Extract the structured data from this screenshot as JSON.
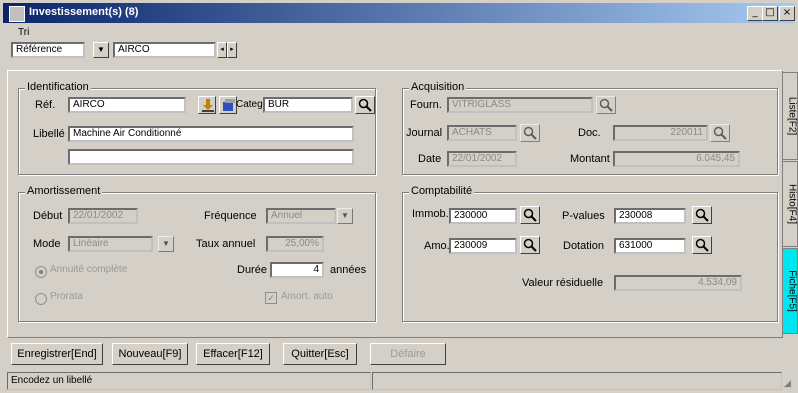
{
  "window": {
    "title": "Investissement(s) (8)"
  },
  "tri": {
    "label": "Tri",
    "select_value": "Référence",
    "search_value": "AIRCO"
  },
  "identification": {
    "title": "Identification",
    "ref_label": "Réf.",
    "ref_value": "AIRCO",
    "categ_label": "Categ.",
    "categ_value": "BUR",
    "libelle_label": "Libellé",
    "libelle_value": "Machine Air Conditionné",
    "libelle2_value": ""
  },
  "acquisition": {
    "title": "Acquisition",
    "fourn_label": "Fourn.",
    "fourn_value": "VITRIGLASS",
    "journal_label": "Journal",
    "journal_value": "ACHATS",
    "doc_label": "Doc.",
    "doc_value": "220011",
    "date_label": "Date",
    "date_value": "22/01/2002",
    "montant_label": "Montant",
    "montant_value": "6.045,45"
  },
  "amortissement": {
    "title": "Amortissement",
    "debut_label": "Début",
    "debut_value": "22/01/2002",
    "frequence_label": "Fréquence",
    "frequence_value": "Annuel",
    "mode_label": "Mode",
    "mode_value": "Linéaire",
    "taux_label": "Taux annuel",
    "taux_value": "25,00%",
    "duree_label": "Durée",
    "duree_value": "4",
    "annees_label": "années",
    "radio1_label": "Annuité complète",
    "radio2_label": "Prorata",
    "checkbox_label": "Amort. auto"
  },
  "comptabilite": {
    "title": "Comptabilité",
    "immob_label": "Immob.",
    "immob_value": "230000",
    "pvalues_label": "P-values",
    "pvalues_value": "230008",
    "amo_label": "Amo.",
    "amo_value": "230009",
    "dotation_label": "Dotation",
    "dotation_value": "631000",
    "valeur_label": "Valeur résiduelle",
    "valeur_value": "4.534,09"
  },
  "side_tabs": [
    "Liste[F2]",
    "Histo[F4]",
    "Fiche[F5]"
  ],
  "buttons": {
    "enregistrer": "Enregistrer[End]",
    "nouveau": "Nouveau[F9]",
    "effacer": "Effacer[F12]",
    "quitter": "Quitter[Esc]",
    "disabled": "Défaire"
  },
  "status": {
    "message": "Encodez un libellé",
    "right": ""
  },
  "colors": {
    "titlebar_start": "#0a246a",
    "titlebar_end": "#a6caf0",
    "active_tab": "#00e6f0"
  }
}
